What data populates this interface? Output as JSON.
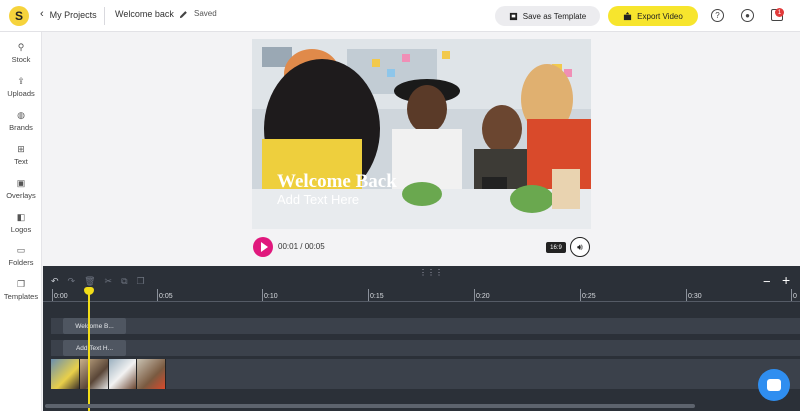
{
  "topbar": {
    "logo_letter": "S",
    "back_label": "My Projects",
    "project_name": "Welcome back",
    "save_status": "Saved",
    "save_template_label": "Save as Template",
    "export_label": "Export Video",
    "notification_count": "1",
    "help_icon": "question-icon",
    "account_icon": "user-icon",
    "gift_icon": "gift-icon"
  },
  "sidebar": {
    "items": [
      {
        "label": "Stock",
        "icon": "search-icon"
      },
      {
        "label": "Uploads",
        "icon": "upload-icon"
      },
      {
        "label": "Brands",
        "icon": "palette-icon"
      },
      {
        "label": "Text",
        "icon": "text-icon"
      },
      {
        "label": "Overlays",
        "icon": "overlay-icon"
      },
      {
        "label": "Logos",
        "icon": "logo-icon"
      },
      {
        "label": "Folders",
        "icon": "folder-icon"
      },
      {
        "label": "Templates",
        "icon": "templates-icon"
      }
    ]
  },
  "stage": {
    "title_overlay": "Welcome Back",
    "subtitle_overlay": "Add Text Here",
    "timecode": "00:01 / 00:05",
    "aspect_ratio": "16:9"
  },
  "timeline": {
    "ticks": [
      "0:00",
      "0:05",
      "0:10",
      "0:15",
      "0:20",
      "0:25",
      "0:30",
      "0"
    ],
    "text_clips": [
      "Welcome B...",
      "Add Text H..."
    ],
    "zoom_out": "−",
    "zoom_in": "+",
    "playhead_time": "00:01"
  },
  "colors": {
    "accent_pink": "#e0187d",
    "export_yellow": "#f7e52d",
    "playhead_yellow": "#f2dd19",
    "timeline_bg": "#2b3038",
    "chat_blue": "#2f8ef0"
  }
}
